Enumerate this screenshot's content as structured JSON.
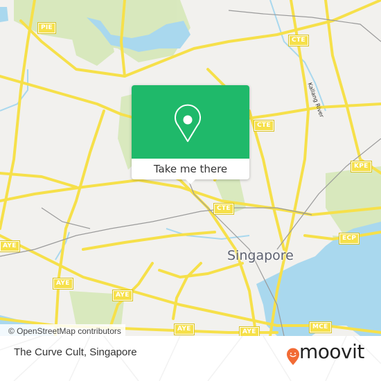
{
  "map": {
    "city_label": "Singapore",
    "river_label": "Kallang River",
    "highway_shields": [
      {
        "label": "PIE"
      },
      {
        "label": "CTE"
      },
      {
        "label": "CTE"
      },
      {
        "label": "CTE"
      },
      {
        "label": "KPE"
      },
      {
        "label": "ECP"
      },
      {
        "label": "AYE"
      },
      {
        "label": "AYE"
      },
      {
        "label": "AYE"
      },
      {
        "label": "AYE"
      },
      {
        "label": "AYE"
      },
      {
        "label": "MCE"
      }
    ],
    "attribution": "© OpenStreetMap contributors",
    "colors": {
      "land": "#f2f1ee",
      "water": "#a9d8ee",
      "park": "#d6e8b8",
      "road": "#f6e04a",
      "accent": "#1fb96a"
    }
  },
  "popup": {
    "icon": "map-pin-icon",
    "button_label": "Take me there"
  },
  "footer": {
    "place_name": "The Curve Cult, Singapore",
    "brand": "moovit",
    "brand_color": "#f26b35"
  }
}
